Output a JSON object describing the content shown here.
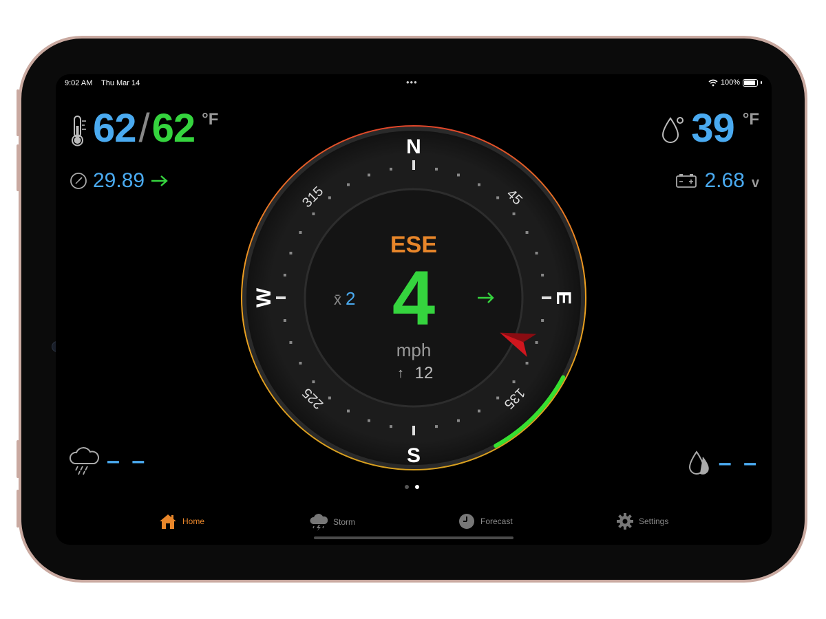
{
  "status": {
    "time": "9:02 AM",
    "date": "Thu Mar 14",
    "battery": "100%",
    "battery_level": 1.0
  },
  "temperature": {
    "icon": "thermometer-icon",
    "current": "62",
    "separator": "/",
    "feels_like": "62",
    "unit": "°F"
  },
  "dew_point": {
    "icon": "dew-drop-icon",
    "value": "39",
    "unit": "°F"
  },
  "barometer": {
    "icon": "gauge-icon",
    "value": "29.89",
    "trend_icon": "arrow-right-icon"
  },
  "battery_voltage": {
    "icon": "battery-icon",
    "value": "2.68",
    "unit": "v"
  },
  "rain": {
    "icon": "rain-cloud-icon",
    "value": "– –"
  },
  "humidity": {
    "icon": "drops-icon",
    "value": "– –"
  },
  "wind": {
    "direction_label": "ESE",
    "speed": "4",
    "unit": "mph",
    "average_symbol": "x̄",
    "average": "2",
    "gust_arrow": "↑",
    "gust": "12",
    "direction_degrees": 112,
    "cardinals": {
      "n": "N",
      "e": "E",
      "s": "S",
      "w": "W"
    },
    "degree_labels": {
      "d45": "45",
      "d135": "135",
      "d225": "225",
      "d315": "315"
    }
  },
  "pages": {
    "count": 2,
    "active": 1
  },
  "tabs": [
    {
      "label": "Home",
      "icon": "home-icon",
      "active": true
    },
    {
      "label": "Storm",
      "icon": "storm-icon",
      "active": false
    },
    {
      "label": "Forecast",
      "icon": "clock-icon",
      "active": false
    },
    {
      "label": "Settings",
      "icon": "gear-icon",
      "active": false
    }
  ],
  "colors": {
    "accent": "#e8862a",
    "blue": "#4aaaf0",
    "green": "#35d43e",
    "pointer": "#c8141c"
  }
}
